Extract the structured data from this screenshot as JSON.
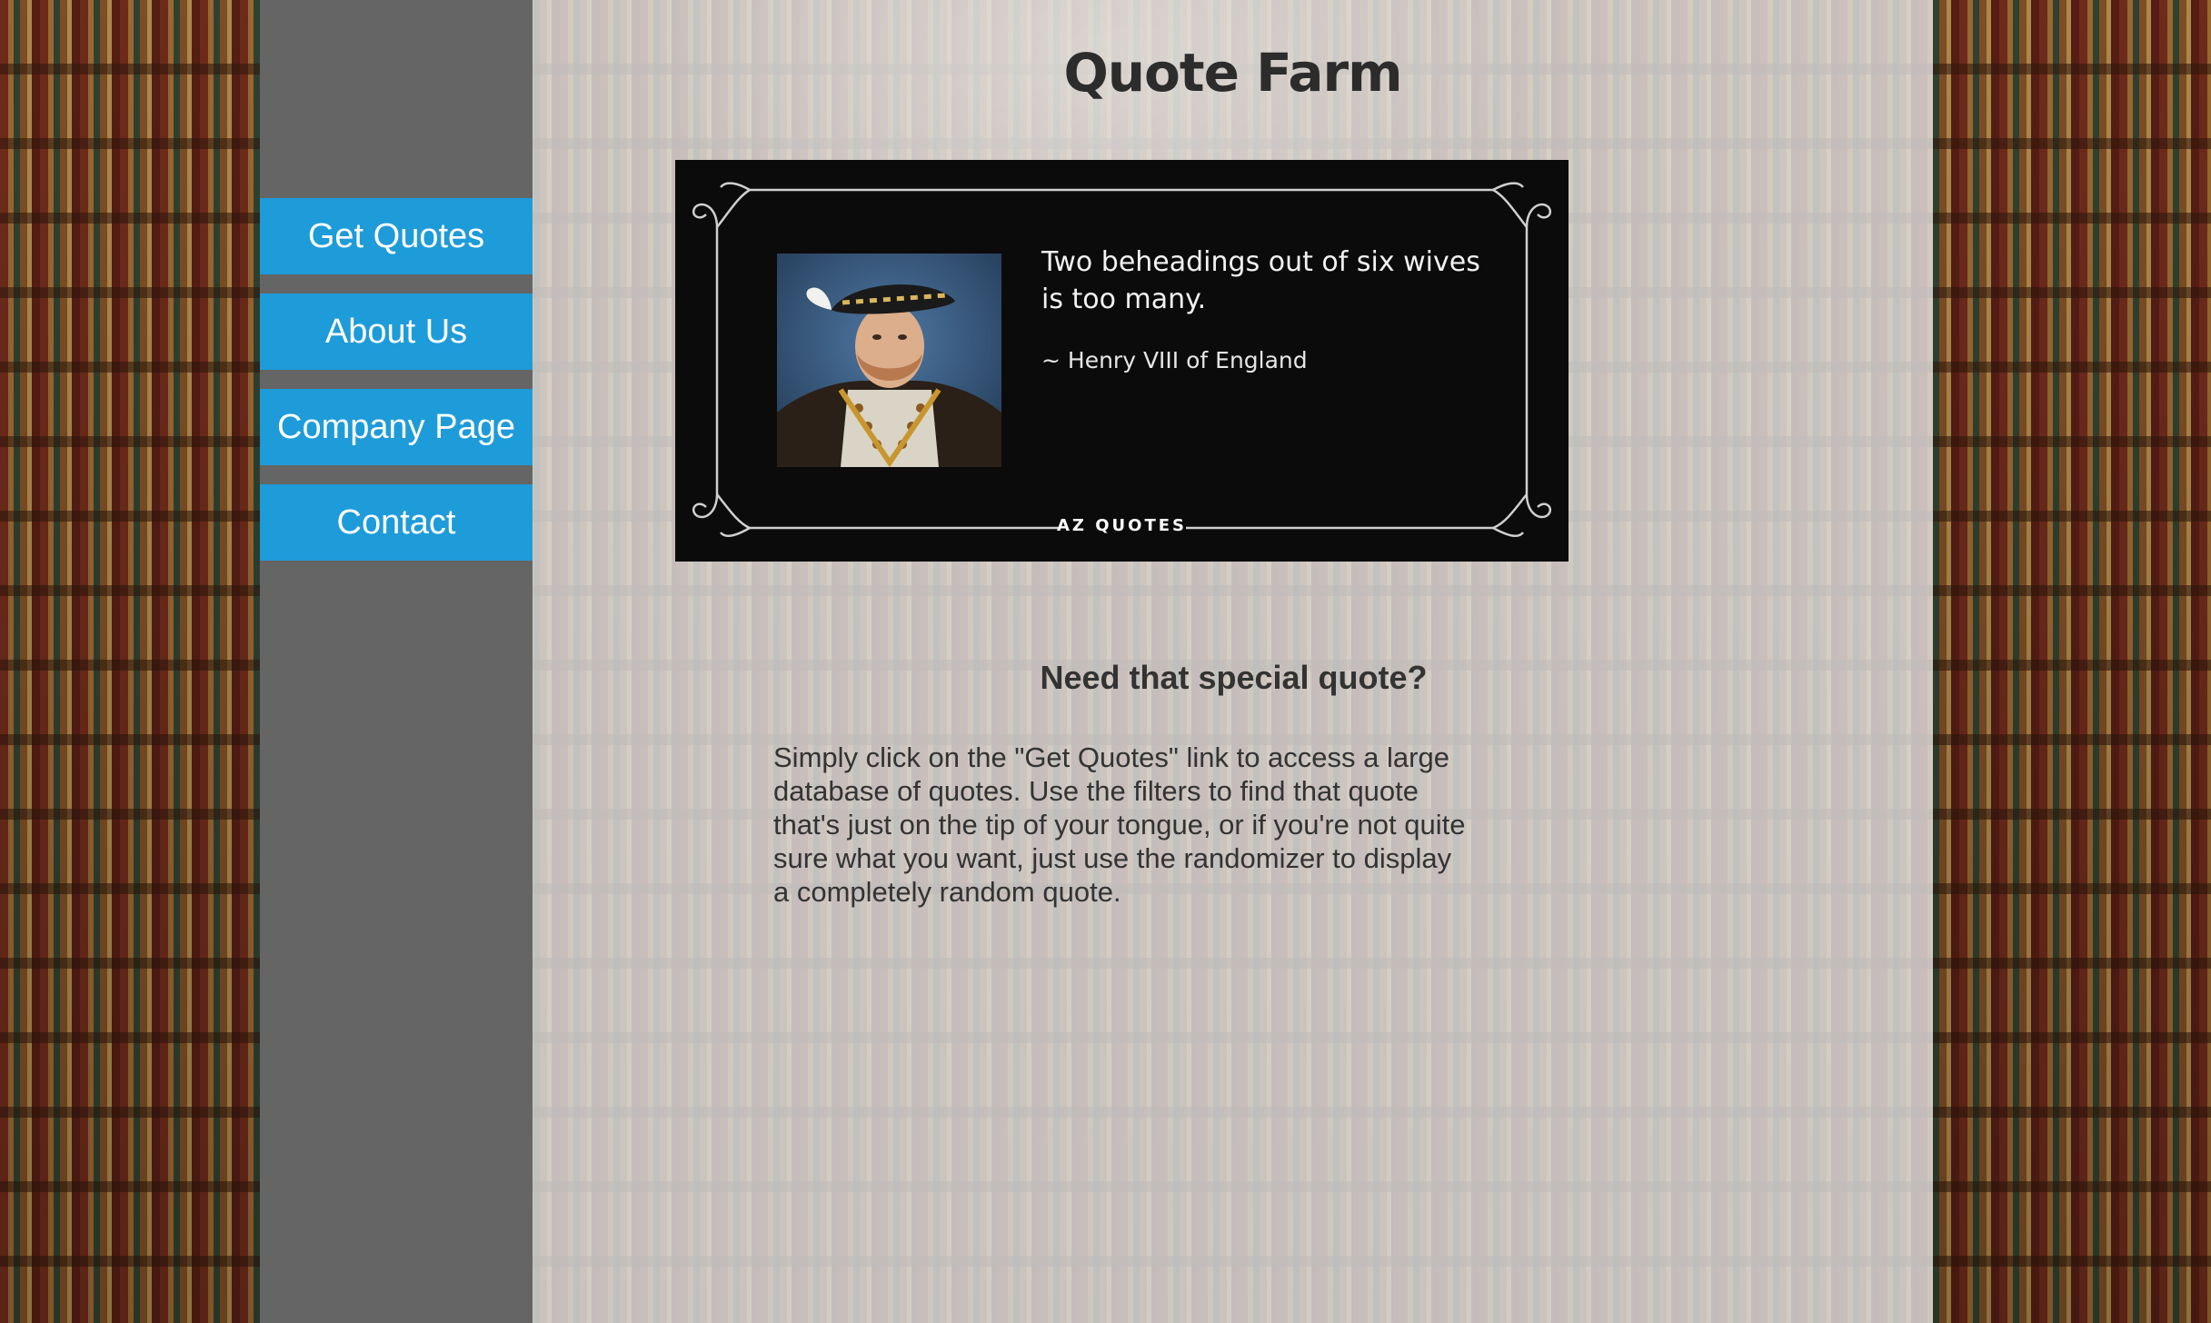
{
  "site": {
    "title": "Quote Farm"
  },
  "nav": {
    "items": [
      {
        "label": "Get Quotes"
      },
      {
        "label": "About Us"
      },
      {
        "label": "Company Page"
      },
      {
        "label": "Contact"
      }
    ]
  },
  "quote_card": {
    "text": "Two beheadings out of six wives is too many.",
    "author": "~ Henry VIII of England",
    "brand": "AZ QUOTES"
  },
  "info": {
    "heading": "Need that special quote?",
    "body": "Simply click on the \"Get Quotes\" link to access a large database of quotes. Use the filters to find that quote that's just on the tip of your tongue, or if you're not quite sure what you want, just use the randomizer to display a completely random quote."
  },
  "colors": {
    "nav_button": "#1e9bd9",
    "sidebar": "#656565",
    "card_background": "#0b0b0b"
  },
  "icons": {
    "portrait": "portrait-image",
    "corner": "scroll-ornament"
  }
}
